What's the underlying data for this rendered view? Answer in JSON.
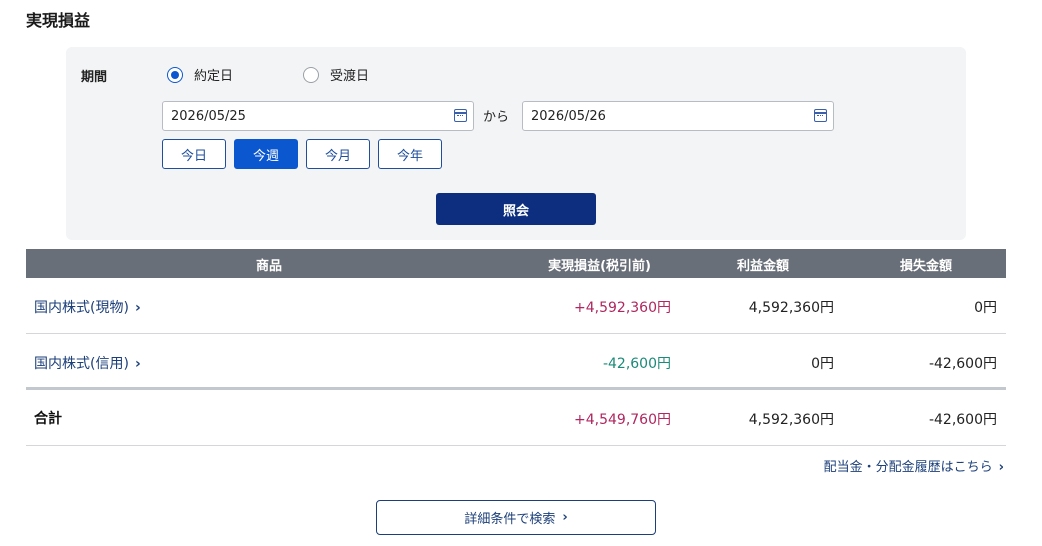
{
  "page": {
    "title": "実現損益"
  },
  "filter": {
    "period_label": "期間",
    "radio_options": [
      {
        "label": "約定日",
        "checked": true
      },
      {
        "label": "受渡日",
        "checked": false
      }
    ],
    "date_from": "2026/05/25",
    "date_to": "2026/05/26",
    "separator": "から",
    "quick_buttons": [
      {
        "label": "今日",
        "active": false
      },
      {
        "label": "今週",
        "active": true
      },
      {
        "label": "今月",
        "active": false
      },
      {
        "label": "今年",
        "active": false
      }
    ],
    "search_button": "照会"
  },
  "table": {
    "headers": [
      "商品",
      "実現損益(税引前)",
      "利益金額",
      "損失金額"
    ],
    "rows": [
      {
        "product": "国内株式(現物)",
        "realized": "+4,592,360円",
        "realized_sign": "positive",
        "profit": "4,592,360円",
        "loss": "0円"
      },
      {
        "product": "国内株式(信用)",
        "realized": "-42,600円",
        "realized_sign": "negative",
        "profit": "0円",
        "loss": "-42,600円"
      }
    ],
    "total": {
      "label": "合計",
      "realized": "+4,549,760円",
      "profit": "4,592,360円",
      "loss": "-42,600円"
    }
  },
  "links": {
    "dividend_history": "配当金・分配金履歴はこちら",
    "detail_search": "詳細条件で検索"
  },
  "colors": {
    "accent": "#0b57d0",
    "navy_button": "#0d2e7e",
    "header_bg": "#696f78",
    "positive": "#b0265e",
    "negative": "#1b8a78"
  },
  "icons": {
    "chevron": "chevron-right-icon",
    "calendar": "calendar-icon"
  }
}
